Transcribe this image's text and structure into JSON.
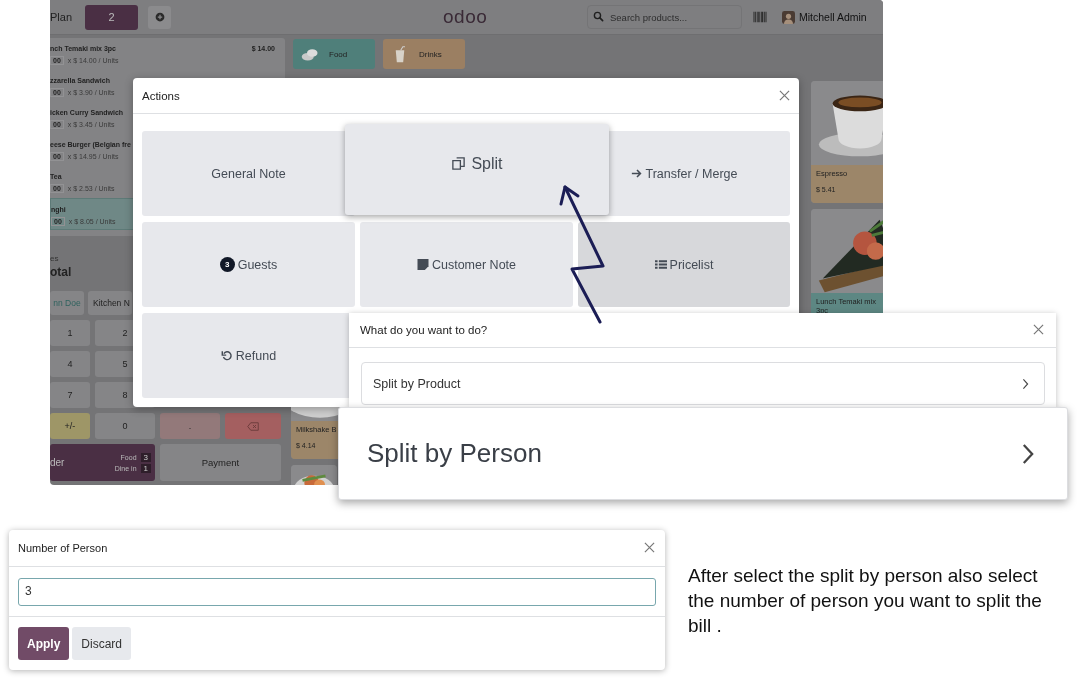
{
  "pos": {
    "topbar": {
      "plan_label": "Plan",
      "floor_tab": {
        "label": "2",
        "selected": true
      },
      "logo": "odoo",
      "search": {
        "placeholder": "Search products..."
      },
      "user": "Mitchell Admin"
    },
    "order_lines": [
      {
        "name": "nch Temaki mix 3pc",
        "qty": "00",
        "unit_price": "x $ 14.00 / Units",
        "price": "$ 14.00",
        "selected": false
      },
      {
        "name": "zzarella Sandwich",
        "qty": "00",
        "unit_price": "x $ 3.90 / Units",
        "selected": false
      },
      {
        "name": "icken Curry Sandwich",
        "qty": "00",
        "unit_price": "x $ 3.45 / Units",
        "selected": false
      },
      {
        "name": "eese Burger (Belgian fre",
        "qty": "00",
        "unit_price": "x $ 14.95 / Units",
        "selected": false
      },
      {
        "name": "Tea",
        "qty": "00",
        "unit_price": "x $ 2.53 / Units",
        "selected": false
      },
      {
        "name": "nghi",
        "qty": "00",
        "unit_price": "x $ 8.05 / Units",
        "selected": true
      }
    ],
    "totals": {
      "taxes_label": "es",
      "total_label": "otal"
    },
    "customer_buttons": [
      "nn Doe",
      "Kitchen N"
    ],
    "keypad": [
      {
        "label": "1",
        "kind": "digit"
      },
      {
        "label": "2",
        "kind": "digit"
      },
      {
        "label": "4",
        "kind": "digit"
      },
      {
        "label": "5",
        "kind": "digit"
      },
      {
        "label": "7",
        "kind": "digit"
      },
      {
        "label": "8",
        "kind": "digit"
      },
      {
        "label": "+/-",
        "kind": "sign"
      },
      {
        "label": "0",
        "kind": "digit"
      },
      {
        "label": ".",
        "kind": "dot"
      },
      {
        "kind": "backspace"
      }
    ],
    "order_button": {
      "label": "der",
      "tags": [
        {
          "label": "Food",
          "count": "3"
        },
        {
          "label": "Dine in",
          "count": "1"
        }
      ]
    },
    "payment_button": "Payment",
    "categories": [
      {
        "label": "Food",
        "color": "#4f7f7a"
      },
      {
        "label": "Drinks",
        "color": "#9b7f62"
      }
    ],
    "products": [
      {
        "kind": "product",
        "name": "Espresso",
        "price": "$ 5.41",
        "color": "#9c8669"
      },
      {
        "kind": "product",
        "name": "Lunch Temaki mix 3pc",
        "color": "#5d8783"
      },
      {
        "kind": "product",
        "name": "Milkshake B",
        "price": "$ 4.14",
        "color": "#9c8669"
      },
      {
        "kind": "picture"
      }
    ]
  },
  "actions_dialog": {
    "title": "Actions",
    "actions": [
      {
        "label": "General Note",
        "kind": "plain",
        "highlighted": false,
        "zoomed": false
      },
      {
        "label": "Split",
        "kind": "split",
        "highlighted": false,
        "zoomed": true
      },
      {
        "label": "Transfer / Merge",
        "kind": "transfer",
        "highlighted": false,
        "zoomed": false
      },
      {
        "label": "Guests",
        "kind": "guests",
        "badge": "3",
        "highlighted": false,
        "zoomed": false
      },
      {
        "label": "Customer Note",
        "kind": "note",
        "highlighted": false,
        "zoomed": false
      },
      {
        "label": "Pricelist",
        "kind": "pricelist",
        "highlighted": true,
        "zoomed": false
      },
      {
        "label": "Refund",
        "kind": "refund",
        "highlighted": false,
        "zoomed": false
      }
    ]
  },
  "choice_dialog": {
    "title": "What do you want to do?",
    "options": [
      "Split by Product"
    ]
  },
  "zoomed_option": "Split by Person",
  "person_dialog": {
    "title": "Number of Person",
    "value": "3",
    "buttons": [
      {
        "label": "Apply",
        "kind": "primary"
      },
      {
        "label": "Discard",
        "kind": "secondary"
      }
    ]
  },
  "caption": "After select the split by person also select the number of person you want to split the bill ."
}
